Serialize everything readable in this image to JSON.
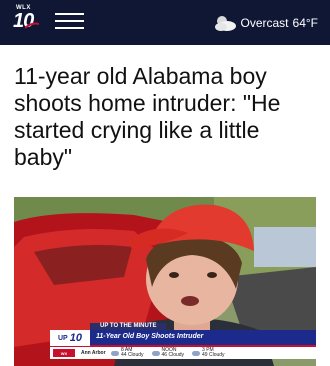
{
  "header": {
    "logo_call": "WLX",
    "logo_number": "10",
    "weather_icon": "partly-cloudy-icon",
    "weather_condition": "Overcast",
    "weather_temp": "64°F"
  },
  "article": {
    "headline": "11-year old Alabama boy shoots home intruder: \"He started crying like a little baby\""
  },
  "video": {
    "lower_third_tag": "UP TO THE MINUTE",
    "lower_third_logo_a": "UP",
    "lower_third_logo_b": "10",
    "lower_third_headline": "11-Year Old Boy Shoots Intruder",
    "ticker_city": "Ann Arbor",
    "ticker_forecast": [
      {
        "time": "8 AM",
        "cond": "44 Cloudy"
      },
      {
        "time": "NOON",
        "cond": "46 Cloudy"
      },
      {
        "time": "3 PM",
        "cond": "49 Cloudy"
      }
    ]
  }
}
